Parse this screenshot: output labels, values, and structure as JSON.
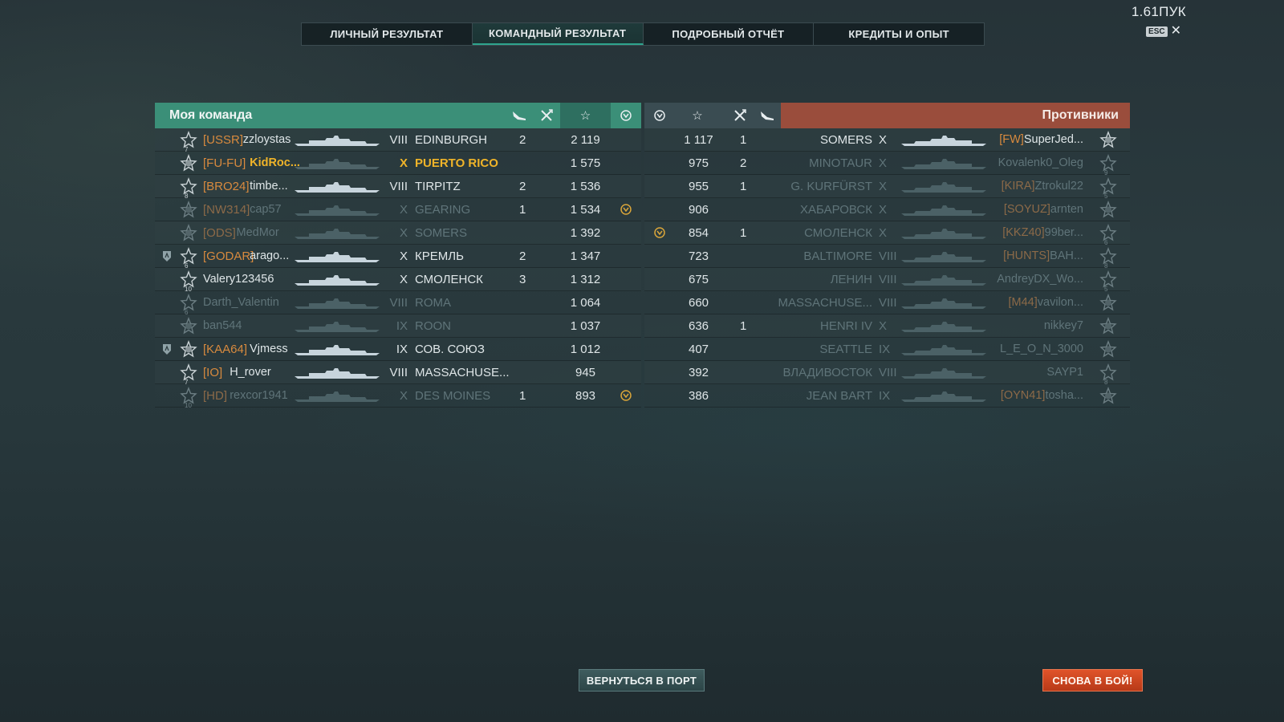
{
  "corner": {
    "title": "1.61ПУК",
    "esc_key": "ESC",
    "close_glyph": "✕"
  },
  "tabs": [
    {
      "label": "ЛИЧНЫЙ РЕЗУЛЬТАТ",
      "active": false
    },
    {
      "label": "КОМАНДНЫЙ РЕЗУЛЬТАТ",
      "active": true
    },
    {
      "label": "ПОДРОБНЫЙ ОТЧЁТ",
      "active": false
    },
    {
      "label": "КРЕДИТЫ И ОПЫТ",
      "active": false
    }
  ],
  "header": {
    "my_team": "Моя команда",
    "enemies": "Противники",
    "icons": {
      "planes": "plane-icon",
      "kills": "crossed-swords-icon",
      "exp": "star-icon",
      "achievement": "laurel-icon"
    }
  },
  "colors": {
    "team_green": "#3b8f78",
    "enemy_red": "#9a4d3c",
    "clan_orange": "#d88a3e",
    "highlight_gold": "#f0b429"
  },
  "my_team": [
    {
      "rank": "7",
      "clan": "[USSR]",
      "name": "zzloystas",
      "tier": "VIII",
      "ship": "EDINBURGH",
      "planes": "2",
      "exp": "2 119",
      "achievement": false,
      "alive": true,
      "me": false,
      "shield": false
    },
    {
      "rank": "",
      "clan": "[FU-FU]",
      "name": "KidRoc...",
      "tier": "X",
      "ship": "PUERTO RICO",
      "planes": "",
      "exp": "1 575",
      "achievement": false,
      "alive": true,
      "me": true,
      "shield": false
    },
    {
      "rank": "8",
      "clan": "[BRO24]",
      "name": "timbe...",
      "tier": "VIII",
      "ship": "TIRPITZ",
      "planes": "2",
      "exp": "1 536",
      "achievement": false,
      "alive": true,
      "me": false,
      "shield": false
    },
    {
      "rank": "",
      "clan": "[NW314]",
      "name": "cap57",
      "tier": "X",
      "ship": "GEARING",
      "planes": "1",
      "exp": "1 534",
      "achievement": true,
      "alive": false,
      "me": false,
      "shield": false
    },
    {
      "rank": "",
      "clan": "[ODS]",
      "name": "MedMor",
      "tier": "X",
      "ship": "SOMERS",
      "planes": "",
      "exp": "1 392",
      "achievement": false,
      "alive": false,
      "me": false,
      "shield": false
    },
    {
      "rank": "6",
      "clan": "[GODAR]",
      "name": "arago...",
      "tier": "X",
      "ship": "КРЕМЛЬ",
      "planes": "2",
      "exp": "1 347",
      "achievement": false,
      "alive": true,
      "me": false,
      "shield": true
    },
    {
      "rank": "10",
      "clan": "",
      "name": "Valery123456",
      "tier": "X",
      "ship": "СМОЛЕНСК",
      "planes": "3",
      "exp": "1 312",
      "achievement": false,
      "alive": true,
      "me": false,
      "shield": false
    },
    {
      "rank": "6",
      "clan": "",
      "name": "Darth_Valentin",
      "tier": "VIII",
      "ship": "ROMA",
      "planes": "",
      "exp": "1 064",
      "achievement": false,
      "alive": false,
      "me": false,
      "shield": false
    },
    {
      "rank": "",
      "clan": "",
      "name": "ban544",
      "tier": "IX",
      "ship": "ROON",
      "planes": "",
      "exp": "1 037",
      "achievement": false,
      "alive": false,
      "me": false,
      "shield": false
    },
    {
      "rank": "",
      "clan": "[KAA64]",
      "name": "Vjmess",
      "tier": "IX",
      "ship": "СОВ. СОЮЗ",
      "planes": "",
      "exp": "1 012",
      "achievement": false,
      "alive": true,
      "me": false,
      "shield": true
    },
    {
      "rank": "7",
      "clan": "[IO]",
      "name": "H_rover",
      "tier": "VIII",
      "ship": "MASSACHUSE...",
      "planes": "",
      "exp": "945",
      "achievement": false,
      "alive": true,
      "me": false,
      "shield": false
    },
    {
      "rank": "10",
      "clan": "[HD]",
      "name": "rexcor1941",
      "tier": "X",
      "ship": "DES MOINES",
      "planes": "1",
      "exp": "893",
      "achievement": true,
      "alive": false,
      "me": false,
      "shield": false
    }
  ],
  "enemies": [
    {
      "exp": "1 117",
      "kills": "1",
      "ship": "SOMERS",
      "tier": "X",
      "clan": "[FW]",
      "name": "SuperJed...",
      "rank": "",
      "achievement": false,
      "alive": true
    },
    {
      "exp": "975",
      "kills": "2",
      "ship": "MINOTAUR",
      "tier": "X",
      "clan": "",
      "name": "Kovalenk0_Oleg",
      "rank": "9",
      "achievement": false,
      "alive": false
    },
    {
      "exp": "955",
      "kills": "1",
      "ship": "G. KURFÜRST",
      "tier": "X",
      "clan": "[KIRA]",
      "name": "Ztrokul22",
      "rank": "5",
      "achievement": false,
      "alive": false
    },
    {
      "exp": "906",
      "kills": "",
      "ship": "ХАБАРОВСК",
      "tier": "X",
      "clan": "[SOYUZ]",
      "name": "arnten",
      "rank": "",
      "achievement": false,
      "alive": false
    },
    {
      "exp": "854",
      "kills": "1",
      "ship": "СМОЛЕНСК",
      "tier": "X",
      "clan": "[KKZ40]",
      "name": "99ber...",
      "rank": "6",
      "achievement": true,
      "alive": false
    },
    {
      "exp": "723",
      "kills": "",
      "ship": "BALTIMORE",
      "tier": "VIII",
      "clan": "[HUNTS]",
      "name": "BAH...",
      "rank": "8",
      "achievement": false,
      "alive": false
    },
    {
      "exp": "675",
      "kills": "",
      "ship": "ЛЕНИН",
      "tier": "VIII",
      "clan": "",
      "name": "AndreyDX_Wo...",
      "rank": "5",
      "achievement": false,
      "alive": false
    },
    {
      "exp": "660",
      "kills": "",
      "ship": "MASSACHUSE...",
      "tier": "VIII",
      "clan": "[M44]",
      "name": "vavilon...",
      "rank": "",
      "achievement": false,
      "alive": false
    },
    {
      "exp": "636",
      "kills": "1",
      "ship": "HENRI IV",
      "tier": "X",
      "clan": "",
      "name": "nikkey7",
      "rank": "",
      "achievement": false,
      "alive": false
    },
    {
      "exp": "407",
      "kills": "",
      "ship": "SEATTLE",
      "tier": "IX",
      "clan": "",
      "name": "L_E_O_N_3000",
      "rank": "",
      "achievement": false,
      "alive": false
    },
    {
      "exp": "392",
      "kills": "",
      "ship": "ВЛАДИВОСТОК",
      "tier": "VIII",
      "clan": "",
      "name": "SAYP1",
      "rank": "8",
      "achievement": false,
      "alive": false
    },
    {
      "exp": "386",
      "kills": "",
      "ship": "JEAN BART",
      "tier": "IX",
      "clan": "[OYN41]",
      "name": "tosha...",
      "rank": "",
      "achievement": false,
      "alive": false
    }
  ],
  "buttons": {
    "port": "ВЕРНУТЬСЯ В ПОРТ",
    "battle": "СНОВА В БОЙ!"
  }
}
